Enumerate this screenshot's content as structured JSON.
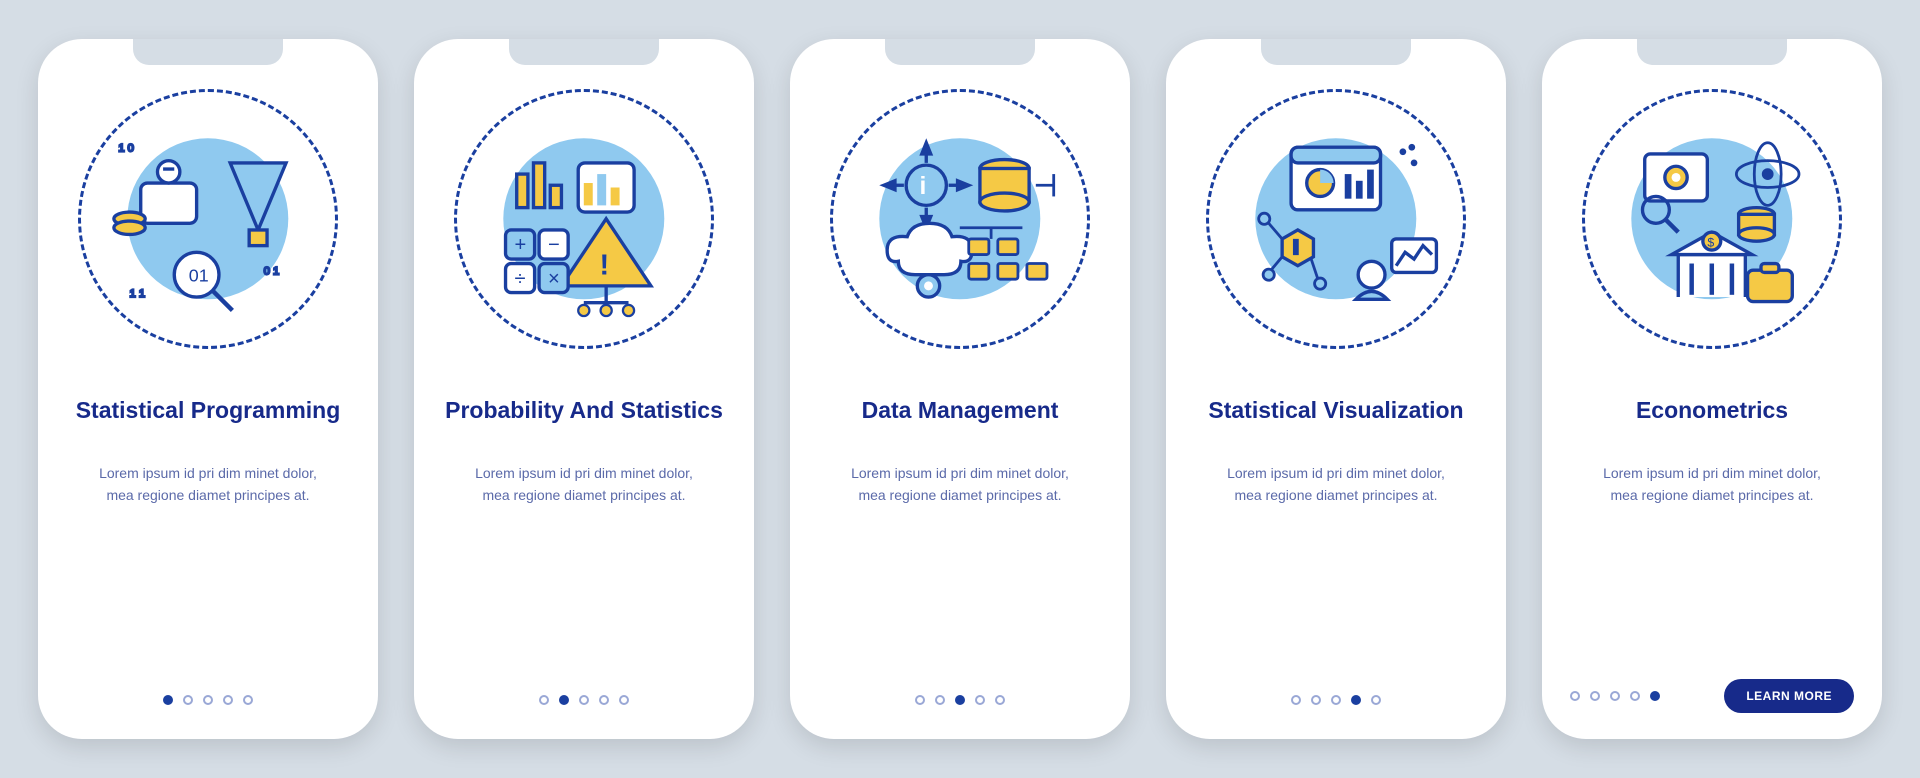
{
  "cards": [
    {
      "title": "Statistical Programming",
      "iconName": "statistical-programming-illustration",
      "desc": "Lorem ipsum id pri dim minet dolor, mea regione diamet principes at."
    },
    {
      "title": "Probability And Statistics",
      "iconName": "probability-statistics-illustration",
      "desc": "Lorem ipsum id pri dim minet dolor, mea regione diamet principes at."
    },
    {
      "title": "Data Management",
      "iconName": "data-management-illustration",
      "desc": "Lorem ipsum id pri dim minet dolor, mea regione diamet principes at."
    },
    {
      "title": "Statistical Visualization",
      "iconName": "statistical-visualization-illustration",
      "desc": "Lorem ipsum id pri dim minet dolor, mea regione diamet principes at."
    },
    {
      "title": "Econometrics",
      "iconName": "econometrics-illustration",
      "desc": "Lorem ipsum id pri dim minet dolor, mea regione diamet principes at."
    }
  ],
  "totalDots": 5,
  "cta_label": "LEARN MORE",
  "colors": {
    "navy": "#172a8a",
    "outline": "#1a3fa0",
    "yellow": "#f5c945",
    "blue": "#8fc9ef",
    "bg": "#d5dde5"
  }
}
